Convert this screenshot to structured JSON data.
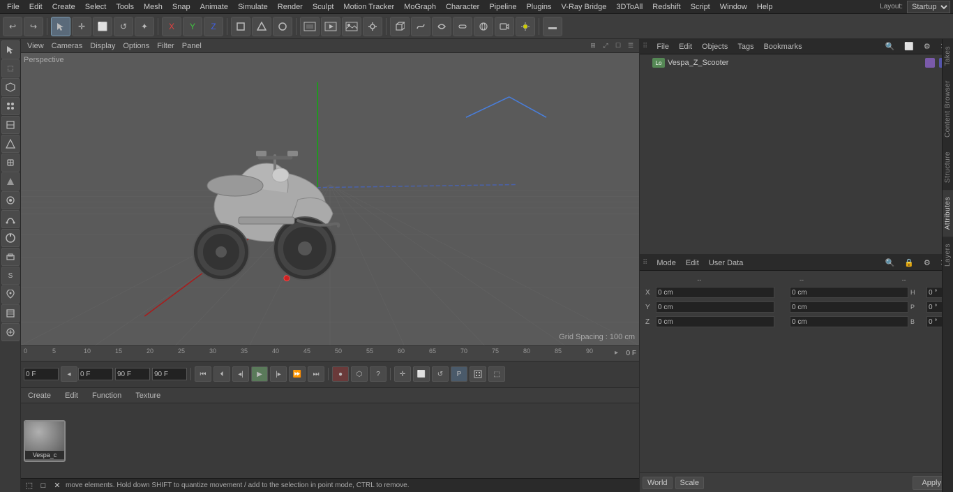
{
  "menubar": {
    "items": [
      "File",
      "Edit",
      "Create",
      "Select",
      "Tools",
      "Mesh",
      "Snap",
      "Animate",
      "Simulate",
      "Render",
      "Sculpt",
      "Motion Tracker",
      "MoGraph",
      "Character",
      "Pipeline",
      "Plugins",
      "V-Ray Bridge",
      "3DToAll",
      "Redshift",
      "Script",
      "Window",
      "Help"
    ],
    "layout_label": "Layout:",
    "layout_value": "Startup"
  },
  "toolbar": {
    "undo_label": "↩",
    "mode_icons": [
      "⬚",
      "✛",
      "□",
      "↺",
      "✦",
      "X",
      "Y",
      "Z",
      "⬡",
      "↻",
      "⬡",
      "⬡",
      "⬡",
      "⬡",
      "⬡",
      "⬡",
      "⬡",
      "⬡",
      "⬡",
      "⬡",
      "⬡",
      "⬡",
      "⬡",
      "⬡",
      "⬡",
      "⬡",
      "⬡",
      "⬡"
    ]
  },
  "viewport": {
    "label": "Perspective",
    "grid_spacing": "Grid Spacing : 100 cm",
    "menu_items": [
      "View",
      "Cameras",
      "Display",
      "Options",
      "Filter",
      "Panel"
    ]
  },
  "timeline": {
    "markers": [
      "0",
      "5",
      "10",
      "15",
      "20",
      "25",
      "30",
      "35",
      "40",
      "45",
      "50",
      "55",
      "60",
      "65",
      "70",
      "75",
      "80",
      "85",
      "90"
    ],
    "current_frame": "0 F",
    "start_frame": "0 F",
    "end_frame": "90 F",
    "end_frame2": "90 F"
  },
  "object_manager": {
    "menu_items": [
      "File",
      "Edit",
      "Objects",
      "Tags",
      "Bookmarks"
    ],
    "objects": [
      {
        "name": "Vespa_Z_Scooter",
        "icon": "Lo",
        "has_tag": true
      }
    ]
  },
  "attributes": {
    "menu_items": [
      "Mode",
      "Edit",
      "User Data"
    ],
    "coords": {
      "x_pos": "0 cm",
      "y_pos": "0 cm",
      "z_pos": "0 cm",
      "x_rot": "0 °",
      "y_rot": "0 °",
      "z_rot": "0 °",
      "h_val": "0 °",
      "p_val": "0 °",
      "b_val": "0 °",
      "x_scale": "0 cm",
      "y_scale": "0 cm",
      "z_scale": "0 cm"
    },
    "coord_labels": {
      "x": "X",
      "y": "Y",
      "z": "Z",
      "h": "H",
      "p": "P",
      "b": "B"
    }
  },
  "coord_bar": {
    "world_label": "World",
    "scale_label": "Scale",
    "apply_label": "Apply"
  },
  "material_editor": {
    "menu_items": [
      "Create",
      "Edit",
      "Function",
      "Texture"
    ],
    "materials": [
      {
        "name": "Vespa_c",
        "color": "#888888"
      }
    ]
  },
  "statusbar": {
    "message": "move elements. Hold down SHIFT to quantize movement / add to the selection in point mode, CTRL to remove.",
    "icons": [
      "⬚",
      "□",
      "✕"
    ]
  },
  "side_tabs": {
    "tabs": [
      "Takes",
      "Content Browser",
      "Structure",
      "Attributes",
      "Layers"
    ]
  },
  "animation_controls": {
    "icons": [
      "⏮",
      "⏪",
      "⏴",
      "▶",
      "⏩",
      "⏭",
      "⟳",
      "⬡",
      "⬡",
      "⬡",
      "⬡",
      "⬡",
      "⬡",
      "⬡",
      "⬡",
      "⬡"
    ]
  }
}
